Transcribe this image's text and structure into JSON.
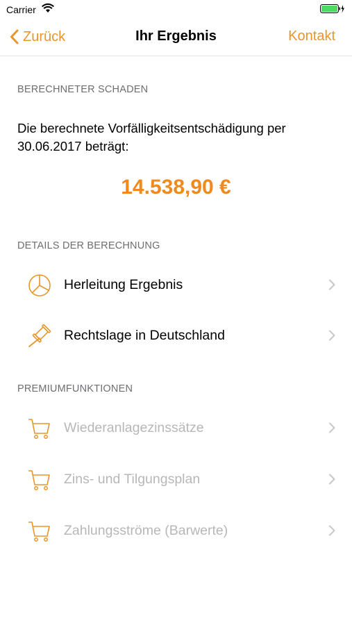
{
  "status_bar": {
    "carrier": "Carrier"
  },
  "nav": {
    "back_label": "Zurück",
    "title": "Ihr Ergebnis",
    "contact_label": "Kontakt"
  },
  "result": {
    "section_header": "BERECHNETER SCHADEN",
    "description": "Die berechnete Vorfälligkeitsentschädigung per 30.06.2017 beträgt:",
    "amount": "14.538,90 €"
  },
  "details": {
    "section_header": "DETAILS DER BERECHNUNG",
    "items": [
      {
        "label": "Herleitung Ergebnis",
        "icon": "pie-chart-icon"
      },
      {
        "label": "Rechtslage in Deutschland",
        "icon": "gavel-icon"
      }
    ]
  },
  "premium": {
    "section_header": "PREMIUMFUNKTIONEN",
    "items": [
      {
        "label": "Wiederanlagezinssätze",
        "icon": "cart-icon"
      },
      {
        "label": "Zins- und Tilgungsplan",
        "icon": "cart-icon"
      },
      {
        "label": "Zahlungsströme (Barwerte)",
        "icon": "cart-icon"
      }
    ]
  },
  "colors": {
    "accent": "#e8952a",
    "amount": "#f08a1c",
    "disabled_text": "#b7b7b9",
    "section_header": "#6d6d72",
    "battery": "#4cd964"
  }
}
